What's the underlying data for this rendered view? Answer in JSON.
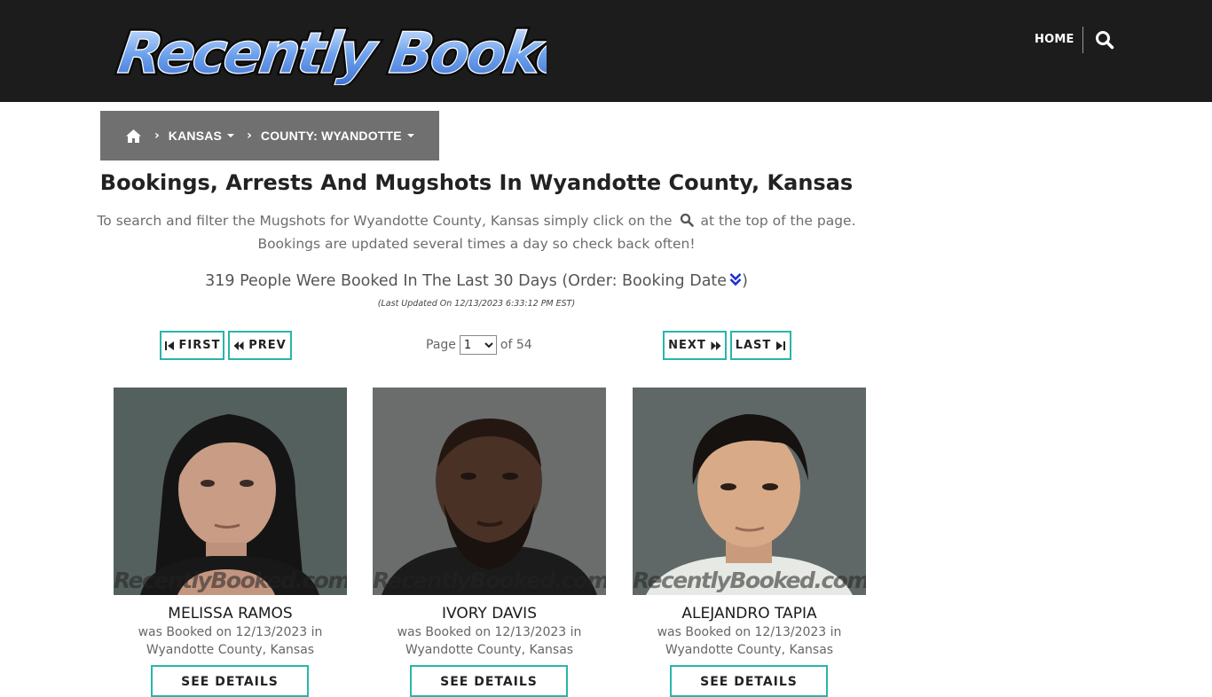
{
  "header": {
    "logo_text": "Recently Booked",
    "nav_home": "HOME",
    "search_icon": "search-icon"
  },
  "breadcrumb": {
    "home_icon": "home-icon",
    "sep": "›",
    "state": "KANSAS",
    "county": "COUNTY: WYANDOTTE"
  },
  "page": {
    "title": "Bookings, Arrests And Mugshots In Wyandotte County, Kansas",
    "intro_before": "To search and filter the Mugshots for Wyandotte County, Kansas simply click on the",
    "intro_after": "at the top of the page.",
    "intro_line2": "Bookings are updated several times a day so check back often!",
    "count_text": "319 People Were Booked In The Last 30 Days (Order: Booking Date",
    "count_close": ")",
    "updated": "(Last Updated On 12/13/2023 6:33:12 PM EST)"
  },
  "pager": {
    "first": "FIRST",
    "prev": "PREV",
    "next": "NEXT",
    "last": "LAST",
    "page_label": "Page",
    "current_page": "1",
    "of_label": "of 54"
  },
  "cards": [
    {
      "name": "MELISSA RAMOS",
      "line1": "was Booked on 12/13/2023 in",
      "line2": "Wyandotte County, Kansas",
      "watermark": "RecentlyBooked.com",
      "button": "SEE DETAILS"
    },
    {
      "name": "IVORY DAVIS",
      "line1": "was Booked on 12/13/2023 in",
      "line2": "Wyandotte County, Kansas",
      "watermark": "RecentlyBooked.com",
      "button": "SEE DETAILS"
    },
    {
      "name": "ALEJANDRO TAPIA",
      "line1": "was Booked on 12/13/2023 in",
      "line2": "Wyandotte County, Kansas",
      "watermark": "RecentlyBooked.com",
      "button": "SEE DETAILS"
    }
  ],
  "colors": {
    "header_bg": "#1c1c1c",
    "breadcrumb_bg": "#707070",
    "accent_teal": "#2ab5aa",
    "sort_icon_blue": "#1a2fd6"
  }
}
